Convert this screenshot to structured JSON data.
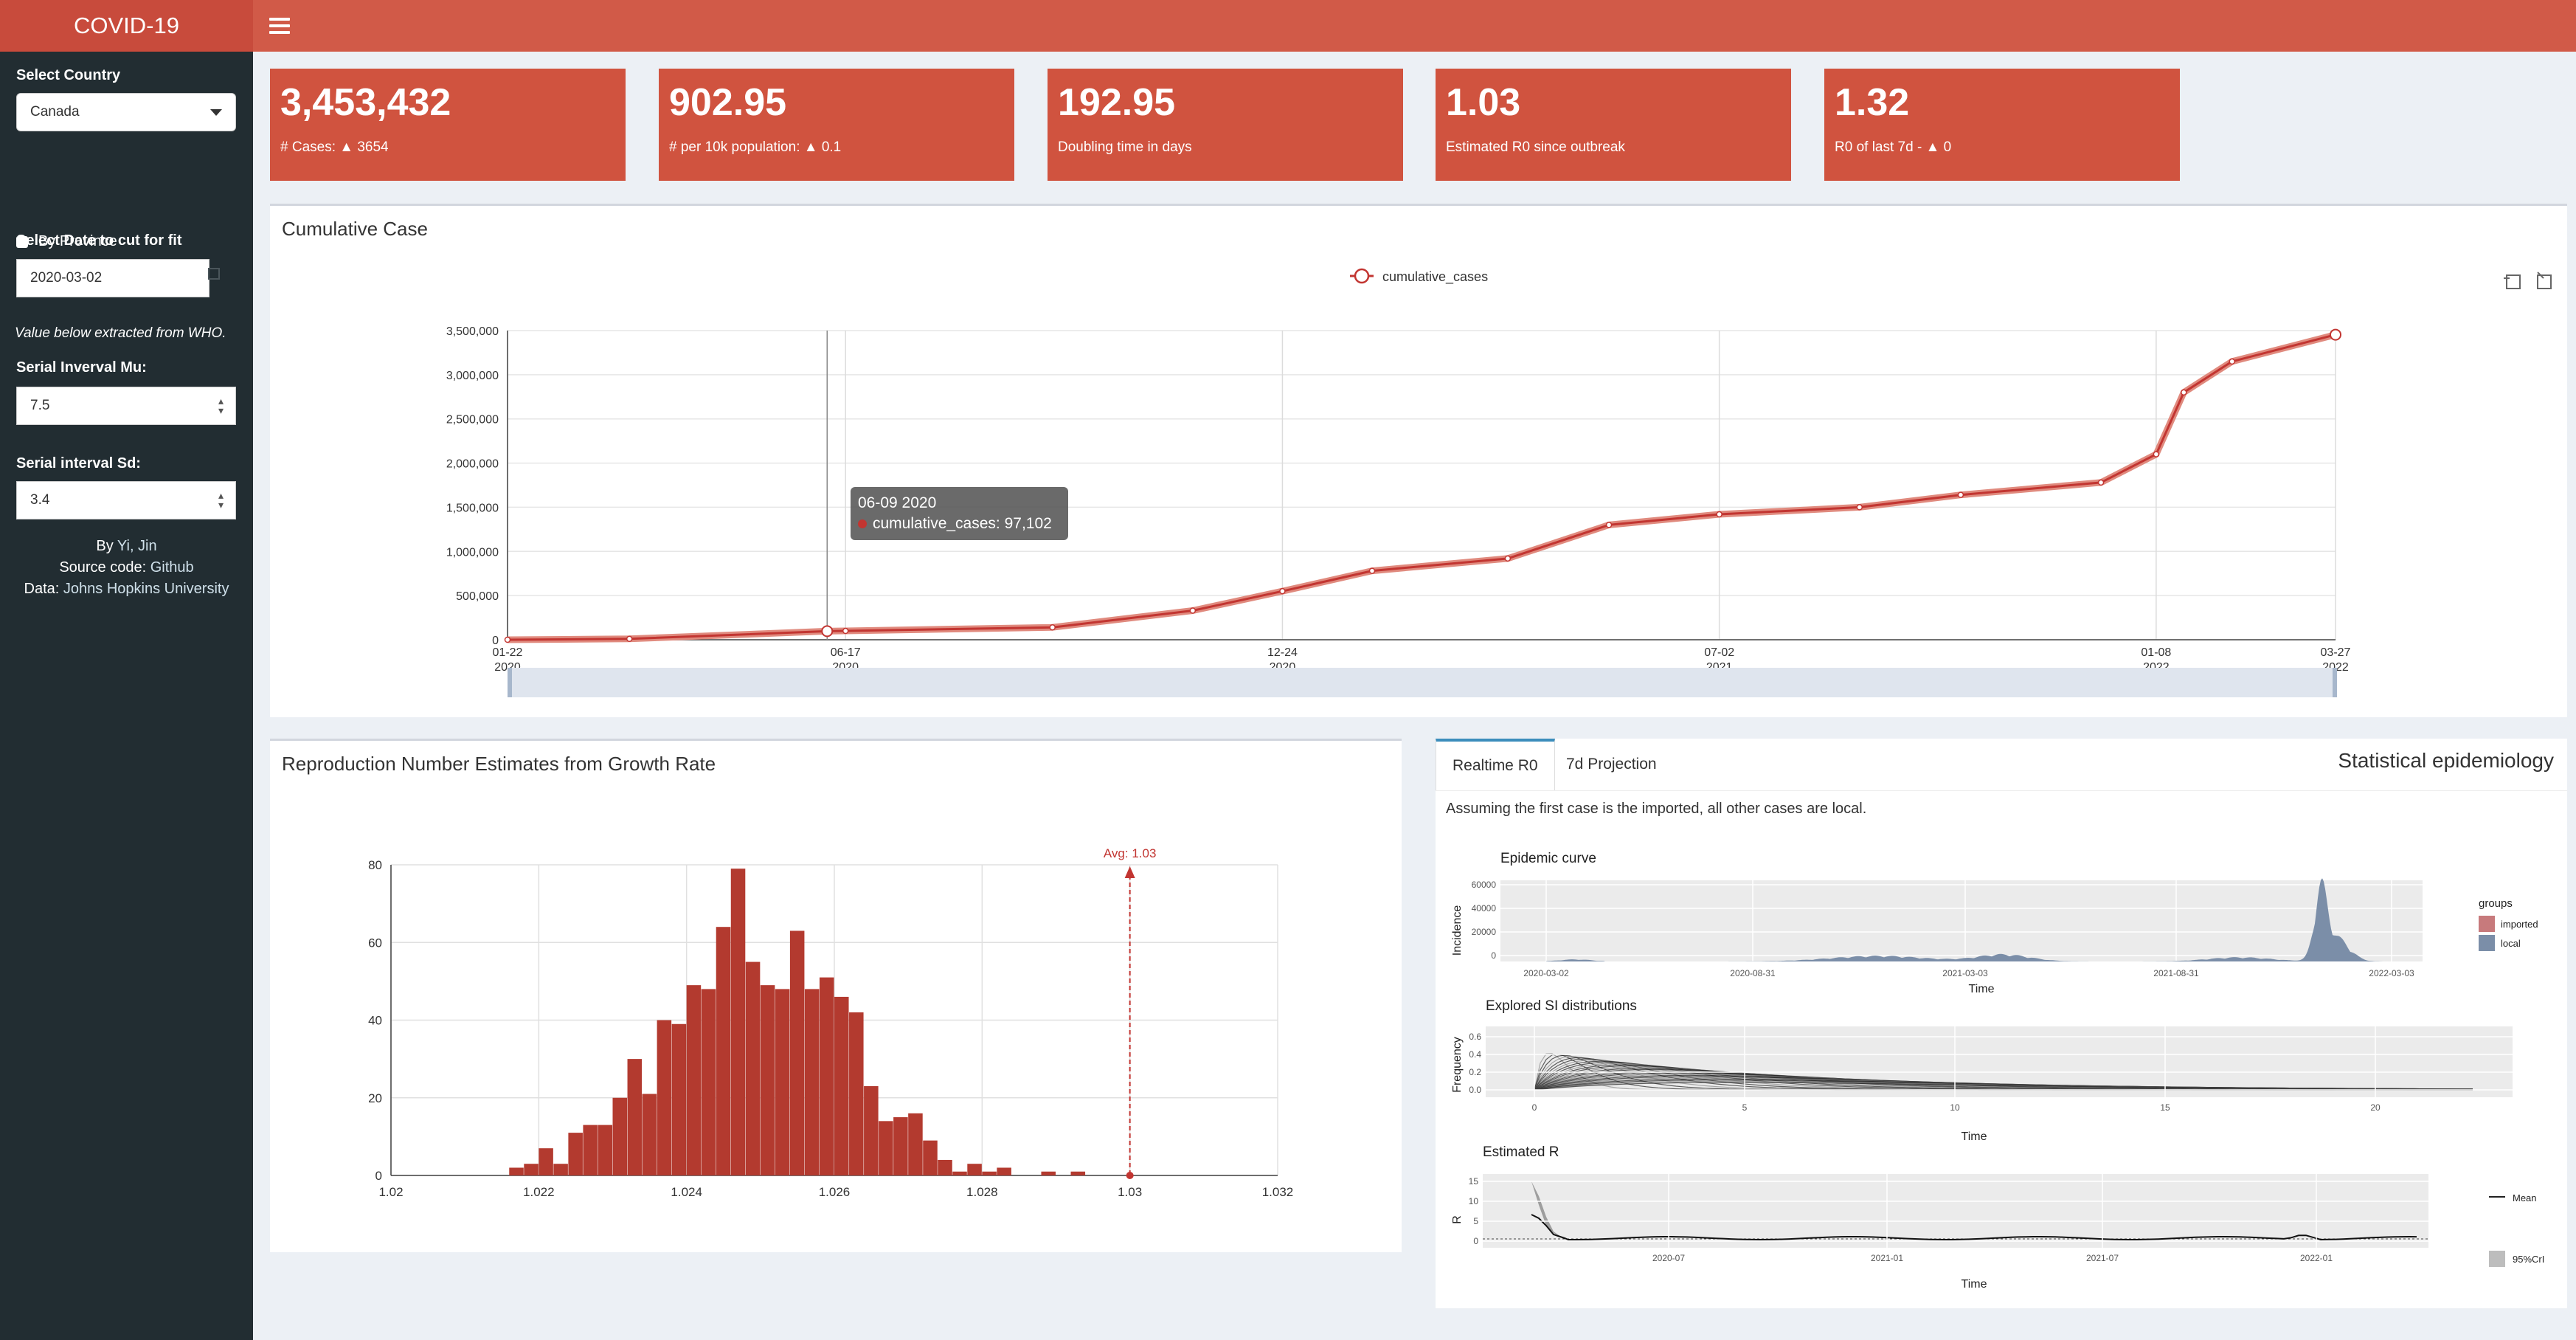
{
  "app": {
    "title": "COVID-19"
  },
  "sidebar": {
    "country_label": "Select Country",
    "country_value": "Canada",
    "province_label": "By Province",
    "date_label": "Select Date to cut for fit",
    "date_value": "2020-03-02",
    "who_note": "Value below extracted from WHO.",
    "mu_label": "Serial Inverval Mu:",
    "mu_value": "7.5",
    "sd_label": "Serial interval Sd:",
    "sd_value": "3.4",
    "by_prefix": "By",
    "author": "Yi, Jin",
    "source_prefix": "Source code:",
    "source_link": "Github",
    "data_prefix": "Data:",
    "data_source": "Johns Hopkins University"
  },
  "value_boxes": [
    {
      "value": "3,453,432",
      "label": "# Cases: ▲ 3654"
    },
    {
      "value": "902.95",
      "label": "# per 10k population: ▲ 0.1"
    },
    {
      "value": "192.95",
      "label": "Doubling time in days"
    },
    {
      "value": "1.03",
      "label": "Estimated R0 since outbreak"
    },
    {
      "value": "1.32",
      "label": "R0 of last 7d - ▲ 0"
    }
  ],
  "cumulative": {
    "title": "Cumulative Case",
    "legend": "cumulative_cases",
    "tooltip_date": "06-09 2020",
    "tooltip_value": "cumulative_cases: 97,102"
  },
  "r_estimate": {
    "title": "Reproduction Number Estimates from Growth Rate"
  },
  "epi": {
    "title": "Statistical epidemiology",
    "tabs": [
      "Realtime R0",
      "7d Projection"
    ],
    "note": "Assuming the first case is the imported, all other cases are local.",
    "curve_title": "Epidemic curve",
    "curve_ylabel": "Incidence",
    "curve_xlabel": "Time",
    "curve_yticks": [
      "60000",
      "40000",
      "20000",
      "0"
    ],
    "curve_xticks": [
      "2020-03-02",
      "2020-08-31",
      "2021-03-03",
      "2021-08-31",
      "2022-03-03"
    ],
    "groups_title": "groups",
    "groups": [
      "imported",
      "local"
    ],
    "si_title": "Explored SI distributions",
    "si_ylabel": "Frequency",
    "si_xlabel": "Time",
    "si_yticks": [
      "0.6",
      "0.4",
      "0.2",
      "0.0"
    ],
    "si_xticks": [
      "0",
      "5",
      "10",
      "15",
      "20"
    ],
    "r_title": "Estimated R",
    "r_ylabel": "R",
    "r_xlabel": "Time",
    "r_yticks": [
      "15",
      "10",
      "5",
      "0"
    ],
    "r_xticks": [
      "2020-07",
      "2021-01",
      "2021-07",
      "2022-01"
    ],
    "r_legend": [
      "Mean",
      "95%CrI"
    ]
  },
  "colors": {
    "header": "#d15a48",
    "brand": "#c84b3c",
    "sidebar": "#222d32",
    "valuebox": "#d0533f",
    "line": "#c23531",
    "bar": "#b33a2f"
  },
  "chart_data": [
    {
      "type": "line",
      "title": "Cumulative Case",
      "series": [
        {
          "name": "cumulative_cases"
        }
      ],
      "x": [
        "2020-01-22",
        "2020-03-15",
        "2020-06-09",
        "2020-06-17",
        "2020-09-15",
        "2020-11-15",
        "2020-12-24",
        "2021-02-01",
        "2021-04-01",
        "2021-05-15",
        "2021-07-02",
        "2021-09-01",
        "2021-10-15",
        "2021-12-15",
        "2022-01-08",
        "2022-01-20",
        "2022-02-10",
        "2022-03-27"
      ],
      "y": [
        0,
        10000,
        97102,
        100000,
        140000,
        330000,
        550000,
        780000,
        920000,
        1300000,
        1420000,
        1500000,
        1640000,
        1780000,
        2100000,
        2800000,
        3150000,
        3453432
      ],
      "x_ticks": [
        {
          "top": "01-22",
          "bottom": "2020"
        },
        {
          "top": "06-17",
          "bottom": "2020"
        },
        {
          "top": "12-24",
          "bottom": "2020"
        },
        {
          "top": "07-02",
          "bottom": "2021"
        },
        {
          "top": "01-08",
          "bottom": "2022"
        },
        {
          "top": "03-27",
          "bottom": "2022"
        }
      ],
      "y_ticks": [
        "0",
        "500,000",
        "1,000,000",
        "1,500,000",
        "2,000,000",
        "2,500,000",
        "3,000,000",
        "3,500,000"
      ],
      "ylim": [
        0,
        3500000
      ]
    },
    {
      "type": "bar",
      "title": "Reproduction Number Estimates from Growth Rate",
      "x_start": 1.0216,
      "bin_width": 0.0002,
      "values": [
        2,
        3,
        7,
        3,
        11,
        13,
        13,
        20,
        30,
        21,
        40,
        39,
        49,
        48,
        64,
        79,
        55,
        49,
        48,
        63,
        48,
        51,
        46,
        42,
        23,
        14,
        15,
        16,
        9,
        4,
        1,
        3,
        1,
        2,
        0,
        0,
        1,
        0,
        1
      ],
      "x_ticks": [
        "1.02",
        "1.022",
        "1.024",
        "1.026",
        "1.028",
        "1.03",
        "1.032"
      ],
      "y_ticks": [
        "0",
        "20",
        "40",
        "60",
        "80"
      ],
      "xlim": [
        1.02,
        1.032
      ],
      "ylim": [
        0,
        80
      ],
      "mark_line": {
        "label": "Avg: 1.03",
        "value": 1.03
      }
    }
  ]
}
